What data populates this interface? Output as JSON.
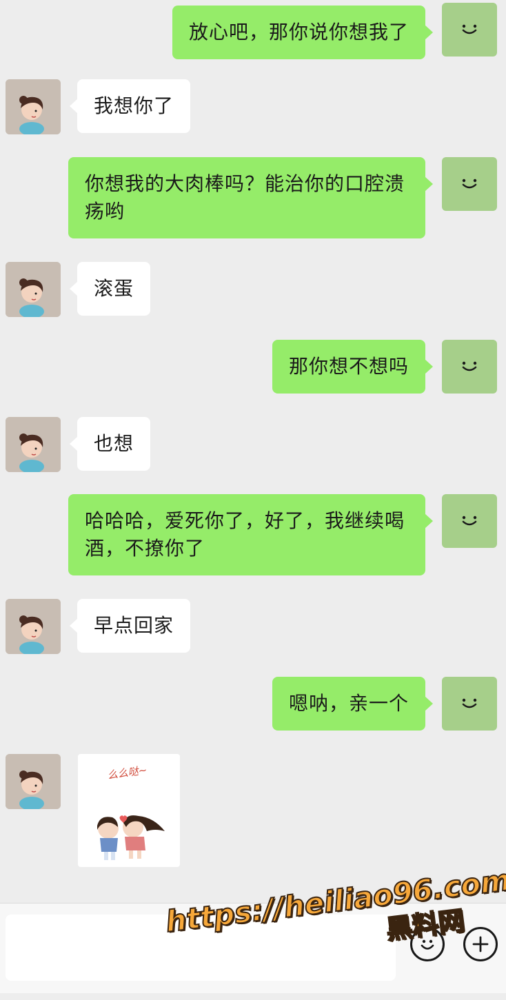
{
  "messages": [
    {
      "side": "out",
      "text": "放心吧，那你说你想我了"
    },
    {
      "side": "in",
      "text": "我想你了"
    },
    {
      "side": "out",
      "text": "你想我的大肉棒吗？能治你的口腔溃疡哟"
    },
    {
      "side": "in",
      "text": "滚蛋"
    },
    {
      "side": "out",
      "text": "那你想不想吗"
    },
    {
      "side": "in",
      "text": "也想"
    },
    {
      "side": "out",
      "text": "哈哈哈，爱死你了，好了，我继续喝酒，不撩你了"
    },
    {
      "side": "in",
      "text": "早点回家"
    },
    {
      "side": "out",
      "text": "嗯呐，亲一个"
    },
    {
      "side": "in",
      "type": "sticker",
      "icon": "kissing-couple-sticker"
    }
  ],
  "sticker": {
    "caption": "么么哒~"
  },
  "composer": {
    "emoji_icon": "smiley-face-icon",
    "plus_icon": "plus-icon"
  },
  "watermark": {
    "url": "https://heiliao96.com",
    "name": "黑料网"
  },
  "colors": {
    "background": "#ededed",
    "outgoing_bubble": "#95ec69",
    "incoming_bubble": "#ffffff",
    "self_avatar": "#a6cf8a",
    "watermark": "#f7a83a"
  }
}
